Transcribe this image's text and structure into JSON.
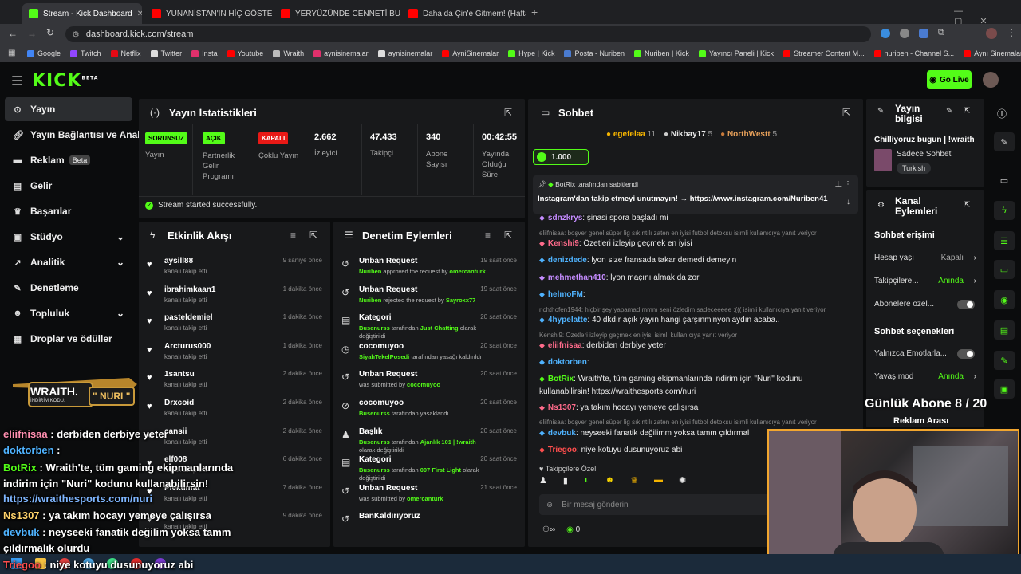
{
  "browser": {
    "tabs": [
      {
        "title": "Stream - Kick Dashboard",
        "color": "#53fc18"
      },
      {
        "title": "YUNANİSTAN'IN HİÇ GÖSTERİL",
        "color": "#ff0000"
      },
      {
        "title": "YERYÜZÜNDE CENNETİ BULDU",
        "color": "#ff0000"
      },
      {
        "title": "Daha da Çin'e Gitmem! (Haftalı",
        "color": "#ff0000"
      }
    ],
    "url": "dashboard.kick.com/stream",
    "bookmarks": [
      "Google",
      "Twitch",
      "Netflix",
      "Twitter",
      "Insta",
      "Youtube",
      "Wraith",
      "aynisinemalar",
      "aynisinemalar",
      "AyniSinemalar",
      "Hype | Kick",
      "Posta - Nuriben",
      "Nuriben | Kick",
      "Yayıncı Paneli | Kick",
      "Streamer Content M...",
      "nuriben - Channel S...",
      "Aynı Sinemalar - Ça..."
    ]
  },
  "header": {
    "logo": "KICK",
    "logo_sup": "BETA",
    "go_live": "Go Live"
  },
  "sidebar": {
    "items": [
      {
        "label": "Yayın",
        "icon": "broadcast-icon"
      },
      {
        "label": "Yayın Bağlantısı ve Anahtar",
        "icon": "link-icon"
      },
      {
        "label": "Reklam",
        "icon": "ad-icon",
        "badge": "Beta"
      },
      {
        "label": "Gelir",
        "icon": "wallet-icon"
      },
      {
        "label": "Başarılar",
        "icon": "trophy-icon"
      },
      {
        "label": "Stüdyo",
        "icon": "studio-icon"
      },
      {
        "label": "Analitik",
        "icon": "chart-icon"
      },
      {
        "label": "Denetleme",
        "icon": "wrench-icon"
      },
      {
        "label": "Topluluk",
        "icon": "community-icon"
      },
      {
        "label": "Droplar ve ödüller",
        "icon": "gift-icon"
      }
    ]
  },
  "stats": {
    "title": "Yayın İstatistikleri",
    "items": [
      {
        "badge": "SORUNSUZ",
        "label": "Yayın",
        "color": "#53fc18"
      },
      {
        "badge": "AÇIK",
        "label": "Partnerlik Gelir Programı",
        "color": "#53fc18"
      },
      {
        "badge": "KAPALI",
        "label": "Çoklu Yayın",
        "color": "#e91916"
      },
      {
        "value": "2.662",
        "label": "İzleyici"
      },
      {
        "value": "47.433",
        "label": "Takipçi"
      },
      {
        "value": "340",
        "label": "Abone Sayısı"
      },
      {
        "value": "00:42:55",
        "label": "Yayında Olduğu Süre"
      }
    ],
    "success": "Stream started successfully."
  },
  "activity": {
    "title": "Etkinlik Akışı",
    "rows": [
      {
        "name": "aysill88",
        "sub": "kanalı takip etti",
        "time": "9 saniye önce"
      },
      {
        "name": "ibrahimkaan1",
        "sub": "kanalı takip etti",
        "time": "1 dakika önce"
      },
      {
        "name": "pasteldemiel",
        "sub": "kanalı takip etti",
        "time": "1 dakika önce"
      },
      {
        "name": "Arcturus000",
        "sub": "kanalı takip etti",
        "time": "1 dakika önce"
      },
      {
        "name": "1santsu",
        "sub": "kanalı takip etti",
        "time": "2 dakika önce"
      },
      {
        "name": "Drxcoid",
        "sub": "kanalı takip etti",
        "time": "2 dakika önce"
      },
      {
        "name": "cansii",
        "sub": "kanalı takip etti",
        "time": "2 dakika önce"
      },
      {
        "name": "elf008",
        "sub": "kanalı takip etti",
        "time": "6 dakika önce"
      },
      {
        "name": "Plekumat",
        "sub": "kanalı takip etti",
        "time": "7 dakika önce"
      },
      {
        "name": "",
        "sub": "kanalı takip etti",
        "time": "9 dakika önce"
      }
    ]
  },
  "moderation": {
    "title": "Denetim Eylemleri",
    "rows": [
      {
        "name": "Unban Request",
        "pre": "Nuriben",
        "mid": " approved the request by ",
        "post": "omercanturk",
        "time": "19 saat önce",
        "icon": "history-icon"
      },
      {
        "name": "Unban Request",
        "pre": "Nuriben",
        "mid": " rejected the request by ",
        "post": "Sayroxx77",
        "time": "19 saat önce",
        "icon": "history-icon"
      },
      {
        "name": "Kategori",
        "pre": "Busenurss",
        "mid": " tarafından ",
        "post": "Just Chatting",
        "tail": " olarak değiştirildi",
        "time": "20 saat önce",
        "icon": "category-icon"
      },
      {
        "name": "cocomuyoo",
        "pre": "SiyahTekelPosedi",
        "mid": " tarafından yasağı kaldırıldı",
        "post": "",
        "time": "20 saat önce",
        "icon": "clock-icon"
      },
      {
        "name": "Unban Request",
        "pre": "",
        "mid": "was submitted by ",
        "post": "cocomuyoo",
        "time": "20 saat önce",
        "icon": "history-icon"
      },
      {
        "name": "cocomuyoo",
        "pre": "Busenurss",
        "mid": " tarafından yasaklandı",
        "post": "",
        "time": "20 saat önce",
        "icon": "ban-icon"
      },
      {
        "name": "Başlık",
        "pre": "Busenurss",
        "mid": " tarafından ",
        "post": "Ajanlık 101 | !wraith",
        "tail": " olarak değiştirildi",
        "time": "20 saat önce",
        "icon": "title-icon"
      },
      {
        "name": "Kategori",
        "pre": "Busenurss",
        "mid": " tarafından ",
        "post": "007 First Light",
        "tail": " olarak değiştirildi",
        "time": "20 saat önce",
        "icon": "category-icon"
      },
      {
        "name": "Unban Request",
        "pre": "",
        "mid": "was submitted by ",
        "post": "omercanturk",
        "time": "21 saat önce",
        "icon": "history-icon"
      },
      {
        "name": "BanKaldırıyoruz",
        "pre": "",
        "mid": "",
        "post": "",
        "time": "",
        "icon": "history-icon"
      }
    ]
  },
  "chat": {
    "title": "Sohbet",
    "top_gifters": [
      {
        "name": "egefelaa",
        "count": "11"
      },
      {
        "name": "Nikbay17",
        "count": "5"
      },
      {
        "name": "NorthWestt",
        "count": "5"
      }
    ],
    "goal": "1.000",
    "pinned_by": "BotRix tarafından sabitlendi",
    "pinned_text": "Instagram'dan takip etmeyi unutmayın! → ",
    "pinned_link": "https://www.instagram.com/Nuriben41",
    "messages": [
      {
        "user": "sdnzkrys",
        "text": ": şinasi spora başladı mi",
        "color": "#c58cff"
      },
      {
        "user": "",
        "text": "eliifnisaa: boşver genel süper lig sıkıntılı zaten en iyisi futbol detoksu isimli kullanıcıya yanıt veriyor",
        "sys": true
      },
      {
        "user": "Kenshi9",
        "text": ": Özetleri izleyip geçmek en iyisi",
        "color": "#ff6b8b"
      },
      {
        "user": "denizdede",
        "text": ": lyon size fransada takar demedi demeyin",
        "color": "#4fb3ff"
      },
      {
        "user": "mehmethan410",
        "text": ": lyon maçını almak da zor",
        "color": "#c58cff"
      },
      {
        "user": "helmoFM",
        "text": ":",
        "color": "#4fb3ff"
      },
      {
        "user": "",
        "text": "richthofen1944: hiçbir şey yapamadımmm seni özledim sadeceeeee :((( isimli kullanıcıya yanıt veriyor",
        "sys": true
      },
      {
        "user": "4hypelatte",
        "text": ": 40 dkdır açık yayın hangi şarşınminyonlaydın acaba..",
        "color": "#4fb3ff"
      },
      {
        "user": "",
        "text": "Kenshi9: Özetleri izleyip geçmek en iyisi isimli kullanıcıya yanıt veriyor",
        "sys": true
      },
      {
        "user": "eliifnisaa",
        "text": ": derbiden derbiye yeter",
        "color": "#ff6b8b"
      },
      {
        "user": "doktorben",
        "text": ":",
        "color": "#4fb3ff"
      },
      {
        "user": "BotRix",
        "text": ": Wraith'te, tüm gaming ekipmanlarında indirim için \"Nuri\" kodunu",
        "color": "#53fc18"
      },
      {
        "user": "",
        "text": "kullanabilirsin! https://wraithesports.com/nuri",
        "cont": true
      },
      {
        "user": "Ns1307",
        "text": ": ya takım hocayı yemeye çalışırsa",
        "color": "#ff6b8b"
      },
      {
        "user": "",
        "text": "eliifnisaa: boşver genel süper lig sıkıntılı zaten en iyisi futbol detoksu isimli kullanıcıya yanıt veriyor",
        "sys": true
      },
      {
        "user": "devbuk",
        "text": ": neyseeki fanatik değilimm",
        "tail": " yoksa tamm çıldırmal",
        "color": "#4fb3ff"
      },
      {
        "user": "Triegoo",
        "text": ": niye kotuyu dusunuyoruz abi",
        "color": "#ff4e4e"
      }
    ],
    "followers_label": "Takipçilere Özel",
    "input_placeholder": "Bir mesaj gönderin",
    "footer_count": "0"
  },
  "stream_info": {
    "title": "Yayın bilgisi",
    "stream_title": "Chilliyoruz bugun | !wraith",
    "category": "Sadece Sohbet",
    "tag": "Turkish"
  },
  "channel_actions": {
    "title": "Kanal Eylemleri",
    "section1": "Sohbet erişimi",
    "rows1": [
      {
        "label": "Hesap yaşı",
        "value": "Kapalı"
      },
      {
        "label": "Takipçilere...",
        "value": "Anında"
      },
      {
        "label": "Abonelere özel...",
        "value": ""
      }
    ],
    "section2": "Sohbet seçenekleri",
    "rows2": [
      {
        "label": "Yalnızca Emotlarla...",
        "value": ""
      },
      {
        "label": "Yavaş mod",
        "value": "Anında"
      }
    ],
    "ad_break": "Reklam Arası"
  },
  "overlay": {
    "sub_goal": "Günlük Abone 8 / 20",
    "wraith_brand": "WRAITH.",
    "wraith_code_label": "İNDİRİM KODU:",
    "wraith_code": "\" NURI \"",
    "chat": [
      {
        "user": "eliifnisaa",
        "text": " : derbiden derbiye yeter",
        "color": "#ff8fb0"
      },
      {
        "user": "doktorben",
        "text": " :",
        "color": "#4fb3ff"
      },
      {
        "user": "BotRix",
        "text": " : Wraith'te, tüm gaming ekipmanlarında",
        "color": "#53fc18"
      },
      {
        "user": "",
        "text": "indirim için \"Nuri\" kodunu kullanabilirsin!"
      },
      {
        "user": "",
        "text": "https://wraithesports.com/nuri",
        "color": "#7fb6ff"
      },
      {
        "user": "Ns1307",
        "text": " : ya takım hocayı yemeye çalışırsa",
        "color": "#ffd36b"
      },
      {
        "user": "devbuk",
        "text": " : neyseeki fanatik değilim",
        "tail": " yoksa tamm",
        "color": "#4fb3ff"
      },
      {
        "user": "",
        "text": "çıldırmalık olurdu"
      },
      {
        "user": "Triegoo",
        "text": " : niye kotuyu dusunuyoruz abi",
        "color": "#ff4e4e"
      }
    ]
  }
}
